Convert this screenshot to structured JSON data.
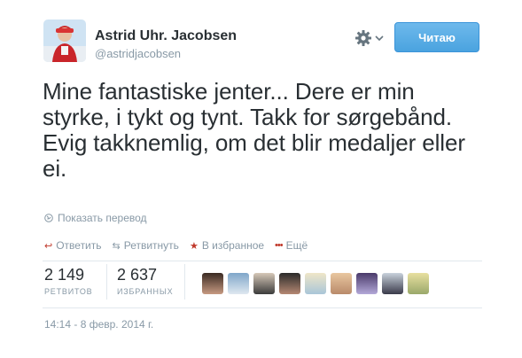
{
  "user": {
    "name": "Astrid Uhr. Jacobsen",
    "handle": "@astridjacobsen"
  },
  "header": {
    "follow_label": "Читаю",
    "settings_icon": "gear-icon"
  },
  "tweet": {
    "text": "Mine fantastiske jenter... Dere er min styrke, i tykt og tynt. Takk for sørgebånd. Evig takknemlig, om det blir medaljer eller ei.",
    "translate_label": "Показать перевод",
    "timestamp": "14:14 - 8 февр. 2014 г."
  },
  "actions": [
    {
      "label": "Ответить",
      "icon": "reply-icon"
    },
    {
      "label": "Ретвитнуть",
      "icon": "retweet-icon"
    },
    {
      "label": "В избранное",
      "icon": "star-icon"
    },
    {
      "label": "Ещё",
      "icon": "more-icon"
    }
  ],
  "stats": {
    "retweets_count": "2 149",
    "retweets_label": "РЕТВИТОВ",
    "favorites_count": "2 637",
    "favorites_label": "ИЗБРАННЫХ"
  },
  "colors": {
    "accent": "#4aa3df",
    "text": "#292f33",
    "muted": "#8899a6",
    "action_red": "#c0392b"
  }
}
